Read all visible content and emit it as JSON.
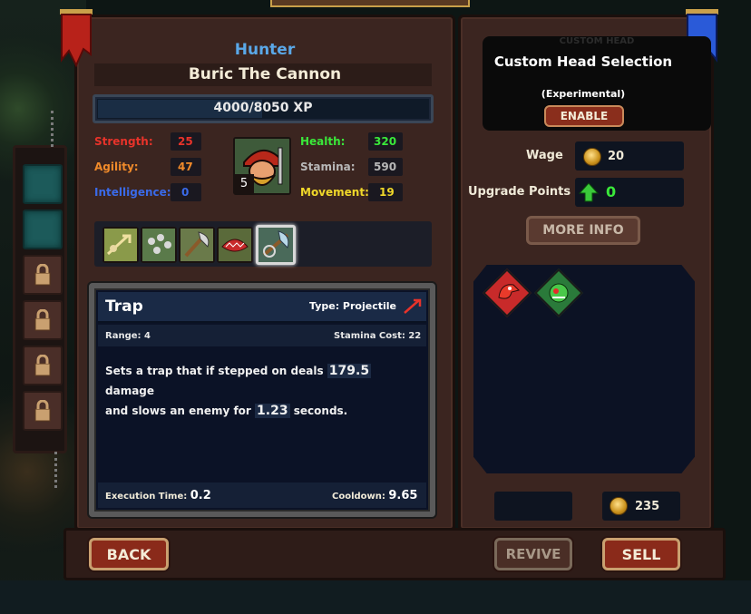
{
  "unit": {
    "class_name": "Hunter",
    "name": "Buric The Cannon",
    "xp_text": "4000/8050 XP",
    "xp_progress": 0.497,
    "level": "5"
  },
  "stats_left": [
    {
      "label": "Strength:",
      "value": "25",
      "color": "#e8332a"
    },
    {
      "label": "Agility:",
      "value": "47",
      "color": "#f08a2a"
    },
    {
      "label": "Intelligence:",
      "value": "0",
      "color": "#3a6ae8"
    }
  ],
  "stats_right": [
    {
      "label": "Health:",
      "value": "320",
      "color": "#3ae83a"
    },
    {
      "label": "Stamina:",
      "value": "590",
      "color": "#b8b8b8"
    },
    {
      "label": "Movement:",
      "value": "19",
      "color": "#f0d82a"
    }
  ],
  "skills": [
    {
      "icon": "arrow-volley-icon",
      "selected": false
    },
    {
      "icon": "multi-shot-icon",
      "selected": false
    },
    {
      "icon": "axe-throw-icon",
      "selected": false
    },
    {
      "icon": "beast-bite-icon",
      "selected": false
    },
    {
      "icon": "trap-icon",
      "selected": true
    }
  ],
  "skill_detail": {
    "title": "Trap",
    "type": "Type: Projectile",
    "range": "Range: 4",
    "stamina_cost": "Stamina Cost: 22",
    "desc_a": "Sets a trap that if stepped on deals",
    "damage": "179.5",
    "desc_b": "damage",
    "desc_c": "and slows an enemy for",
    "duration": "1.23",
    "desc_d": "seconds.",
    "execution_label": "Execution Time:",
    "execution_value": "0.2",
    "cooldown_label": "Cooldown:",
    "cooldown_value": "9.65"
  },
  "custom_head": {
    "ghost_text": "CUSTOM HEAD",
    "title": "Custom Head Selection",
    "subtitle": "(Experimental)",
    "enable_label": "ENABLE"
  },
  "wage": {
    "label": "Wage",
    "value": "20"
  },
  "upgrade": {
    "label": "Upgrade Points",
    "value": "0"
  },
  "more_info_label": "MORE INFO",
  "heads": [
    {
      "icon": "red-bird-head-icon"
    },
    {
      "icon": "green-goblin-head-icon"
    }
  ],
  "gold": "235",
  "buttons": {
    "back": "BACK",
    "revive": "REVIVE",
    "sell": "SELL"
  }
}
